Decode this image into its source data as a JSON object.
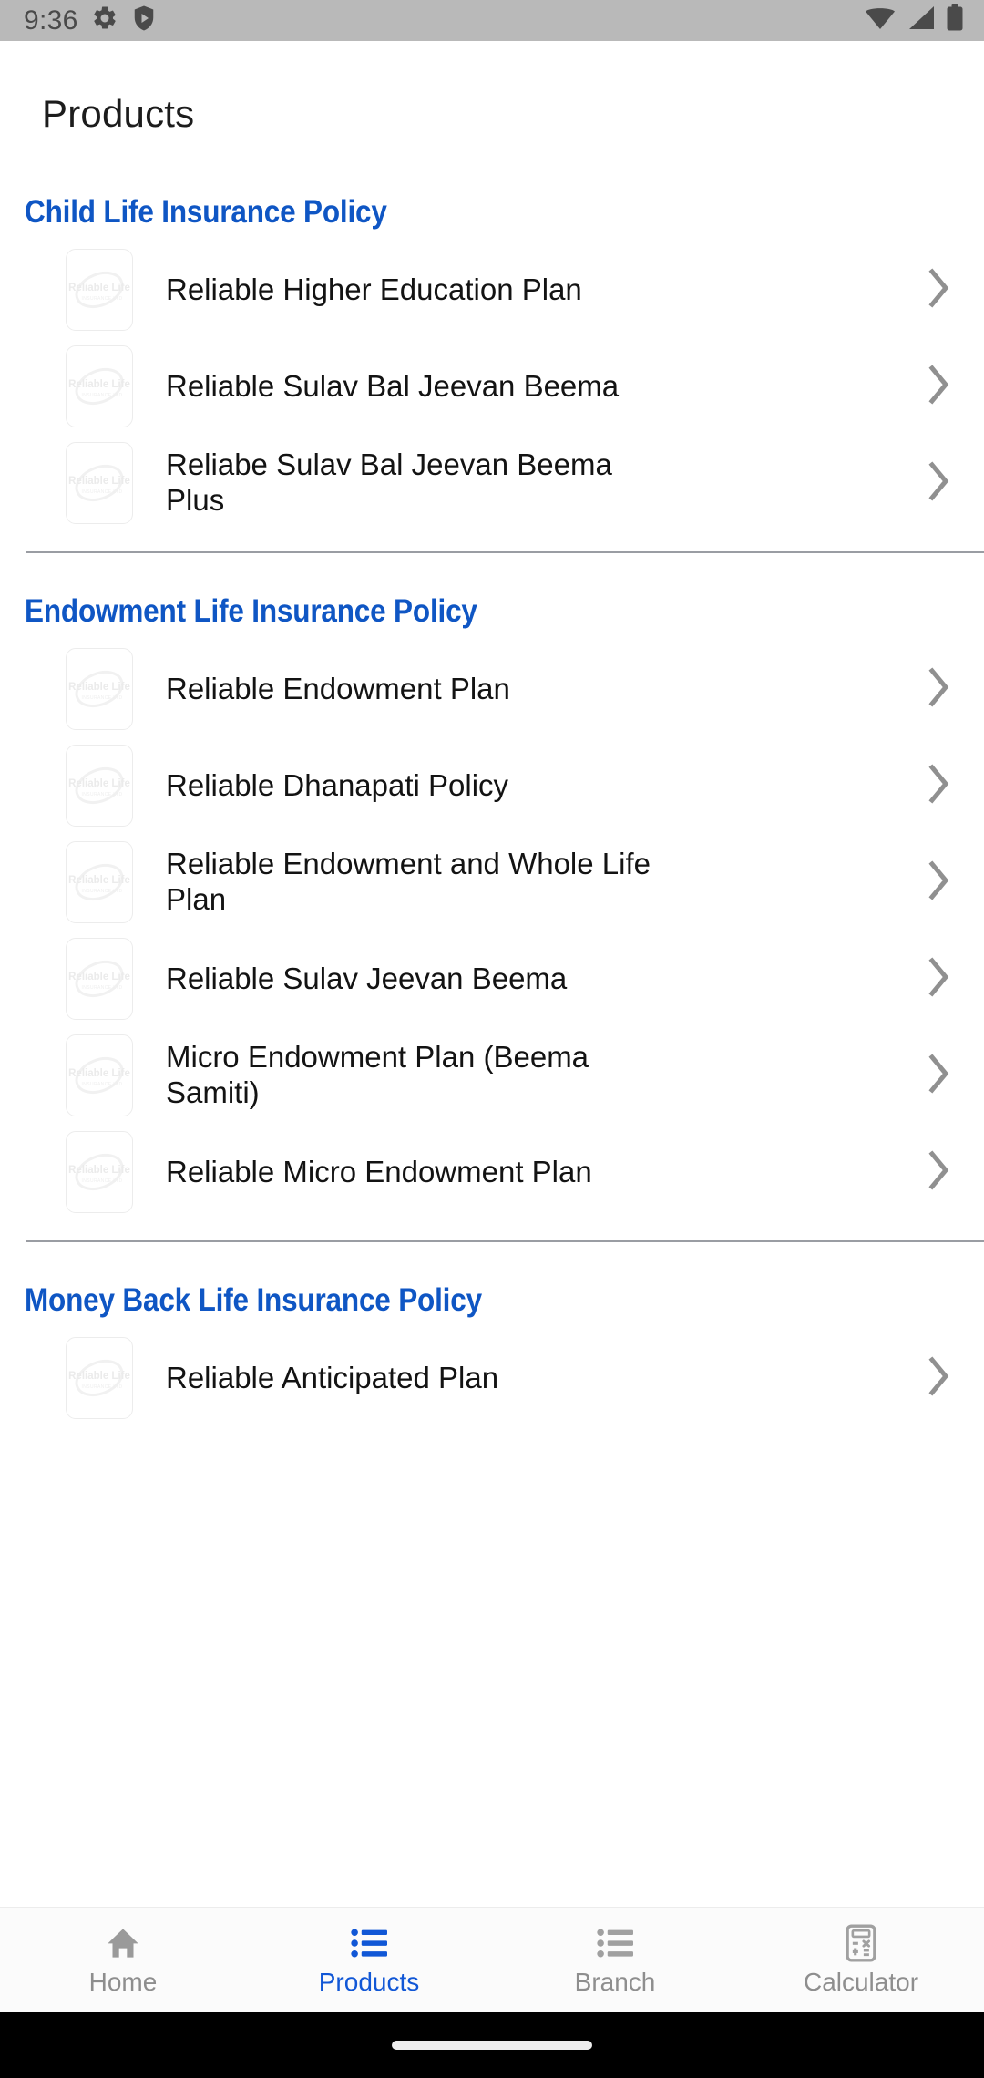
{
  "statusbar": {
    "time": "9:36",
    "left_icons": [
      "gear-icon",
      "shield-play-icon"
    ],
    "right_icons": [
      "wifi-icon",
      "cell-signal-icon",
      "battery-icon"
    ],
    "background_color": "#b9b9b9",
    "icon_color": "#4a4a4a"
  },
  "header": {
    "title": "Products"
  },
  "theme": {
    "accent_blue": "#0f56c4",
    "nav_active_blue": "#1157d6",
    "text_dark": "#131313",
    "chevron_gray": "#909090",
    "divider_gray": "#9a9da3",
    "thumbnail_logo_text": "Reliable Life",
    "thumbnail_logo_subtext": "INSURANCE LTD"
  },
  "sections": [
    {
      "title": "Child Life Insurance Policy",
      "items": [
        {
          "label": "Reliable Higher Education Plan"
        },
        {
          "label": "Reliable Sulav Bal Jeevan Beema"
        },
        {
          "label": "Reliabe Sulav Bal Jeevan Beema Plus"
        }
      ]
    },
    {
      "title": "Endowment Life Insurance Policy",
      "items": [
        {
          "label": "Reliable Endowment Plan"
        },
        {
          "label": "Reliable Dhanapati Policy"
        },
        {
          "label": "Reliable Endowment and Whole Life Plan"
        },
        {
          "label": "Reliable Sulav Jeevan Beema"
        },
        {
          "label": "Micro Endowment Plan (Beema Samiti)"
        },
        {
          "label": "Reliable Micro Endowment Plan"
        }
      ]
    },
    {
      "title": "Money Back Life Insurance Policy",
      "items": [
        {
          "label": "Reliable Anticipated Plan"
        }
      ]
    }
  ],
  "bottom_nav": {
    "items": [
      {
        "label": "Home",
        "icon": "home-icon",
        "active": false
      },
      {
        "label": "Products",
        "icon": "list-icon",
        "active": true
      },
      {
        "label": "Branch",
        "icon": "list-icon",
        "active": false
      },
      {
        "label": "Calculator",
        "icon": "calculator-icon",
        "active": false
      }
    ]
  }
}
